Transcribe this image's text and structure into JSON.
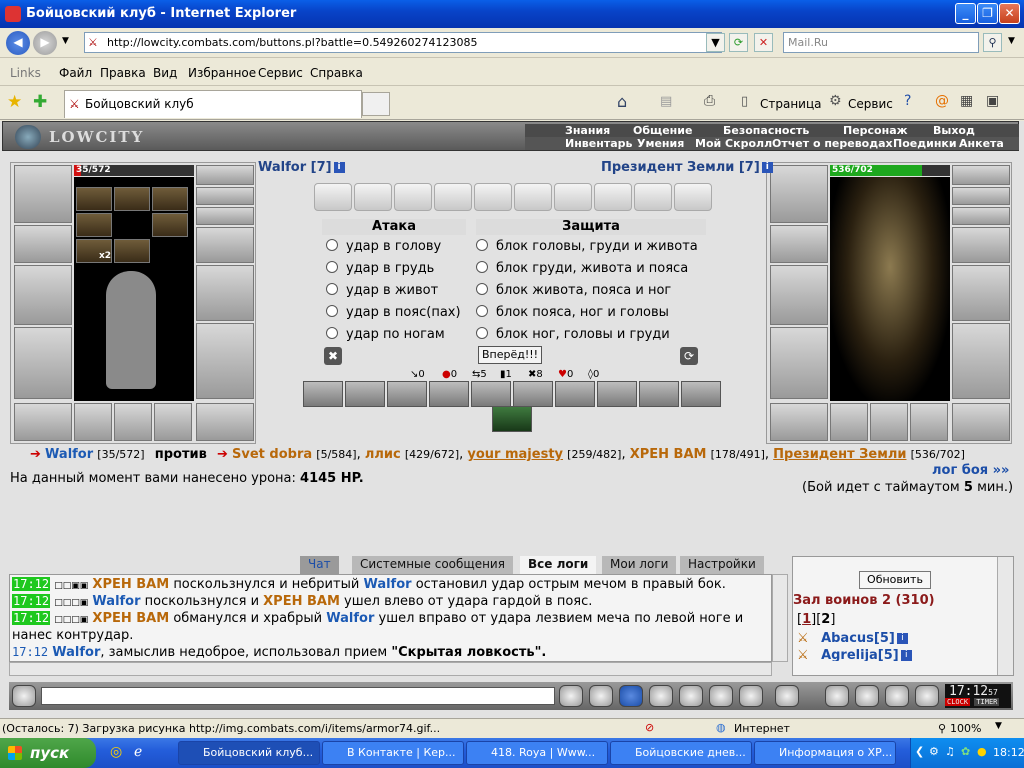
{
  "window": {
    "title": "Бойцовский клуб - Internet Explorer"
  },
  "browser": {
    "url": "http://lowcity.combats.com/buttons.pl?battle=0.549260274123085",
    "search_placeholder": "Mail.Ru",
    "menu": [
      "Links",
      "Файл",
      "Правка",
      "Вид",
      "Избранное",
      "Сервис",
      "Справка"
    ],
    "tab_title": "Бойцовский клуб",
    "tb_page": "Страница",
    "tb_service": "Сервис"
  },
  "game": {
    "logo": "LOWCITY",
    "nav_top": [
      "Знания",
      "Общение",
      "Безопасность",
      "Персонаж",
      "Выход"
    ],
    "nav_bottom": [
      "Инвентарь",
      "Умения",
      "Мой Скролл",
      "Отчет о переводах",
      "Поединки",
      "Анкета"
    ],
    "me": {
      "name": "Walfor [7]",
      "hp": "35/572",
      "hp_frac": 0.061
    },
    "enemy": {
      "name": "Президент Земли [7]",
      "hp": "536/702",
      "hp_frac": 0.763
    },
    "attack_title": "Атака",
    "defense_title": "Защита",
    "attacks": [
      "удар в голову",
      "удар в грудь",
      "удар в живот",
      "удар в пояс(пах)",
      "удар по ногам"
    ],
    "defenses": [
      "блок головы, груди и живота",
      "блок груди, живота и пояса",
      "блок живота, пояса и ног",
      "блок пояса, ног и головы",
      "блок ног, головы и груди"
    ],
    "go_button": "Вперёд!!!",
    "stats": [
      "0",
      "0",
      "5",
      "1",
      "8",
      "0",
      "0"
    ],
    "x2": "x2",
    "vs": {
      "you": "Walfor",
      "you_hp": "[35/572]",
      "against": "против",
      "enemies": [
        {
          "n": "Svet dobra",
          "hp": "[5/584]"
        },
        {
          "n": "ллис",
          "hp": "[429/672]"
        },
        {
          "n": "your majesty",
          "hp": "[259/482]"
        },
        {
          "n": "ХРЕН ВАМ",
          "hp": "[178/491]"
        },
        {
          "n": "Президент Земли",
          "hp": "[536/702]"
        }
      ]
    },
    "damage_label": "На данный момент вами нанесено урона:",
    "damage_value": "4145 HP.",
    "log_link": "лог боя »»",
    "timeout_pre": "(Бой идет с таймаутом",
    "timeout_val": "5",
    "timeout_post": "мин.)"
  },
  "chat": {
    "tabs": [
      "Чат",
      "Системные сообщения",
      "Все логи",
      "Мои логи",
      "Настройки"
    ],
    "lines": [
      {
        "time": "17:12",
        "a": "ХРЕН ВАМ",
        "t1": "поскользнулся и небритый",
        "b": "Walfor",
        "t2": "остановил удар острым мечом в правый бок."
      },
      {
        "time": "17:12",
        "a": "Walfor",
        "t1": "поскользнулся и",
        "b": "ХРЕН ВАМ",
        "t2": "ушел влево от удара гардой в пояс."
      },
      {
        "time": "17:12",
        "a": "ХРЕН ВАМ",
        "t1": "обманулся и храбрый",
        "b": "Walfor",
        "t2": "ушел вправо от удара лезвием меча по левой ноге и"
      },
      {
        "cont": "нанес контрудар."
      },
      {
        "time": "17:12",
        "a": "Walfor",
        "t1": ", замыслив недоброе, использовал прием",
        "q": "\"Скрытая ловкость\"."
      }
    ],
    "refresh": "Обновить",
    "room": "Зал воинов 2 (310)",
    "pages": [
      "1",
      "2"
    ],
    "users": [
      "Abacus[5]",
      "Agrelija[5]"
    ],
    "clock": "17:12",
    "clock_sec": "57",
    "clock_label": "CLOCK",
    "timer_label": "TIMER"
  },
  "status": {
    "text": "(Осталось: 7) Загрузка рисунка http://img.combats.com/i/items/armor74.gif...",
    "zone": "Интернет",
    "zoom": "100%"
  },
  "taskbar": {
    "start": "пуск",
    "tasks": [
      "Бойцовский клуб...",
      "В Контакте | Кер...",
      "418. Roya | Www...",
      "Бойцовские днев...",
      "Информация о ХР..."
    ],
    "time": "18:12"
  }
}
